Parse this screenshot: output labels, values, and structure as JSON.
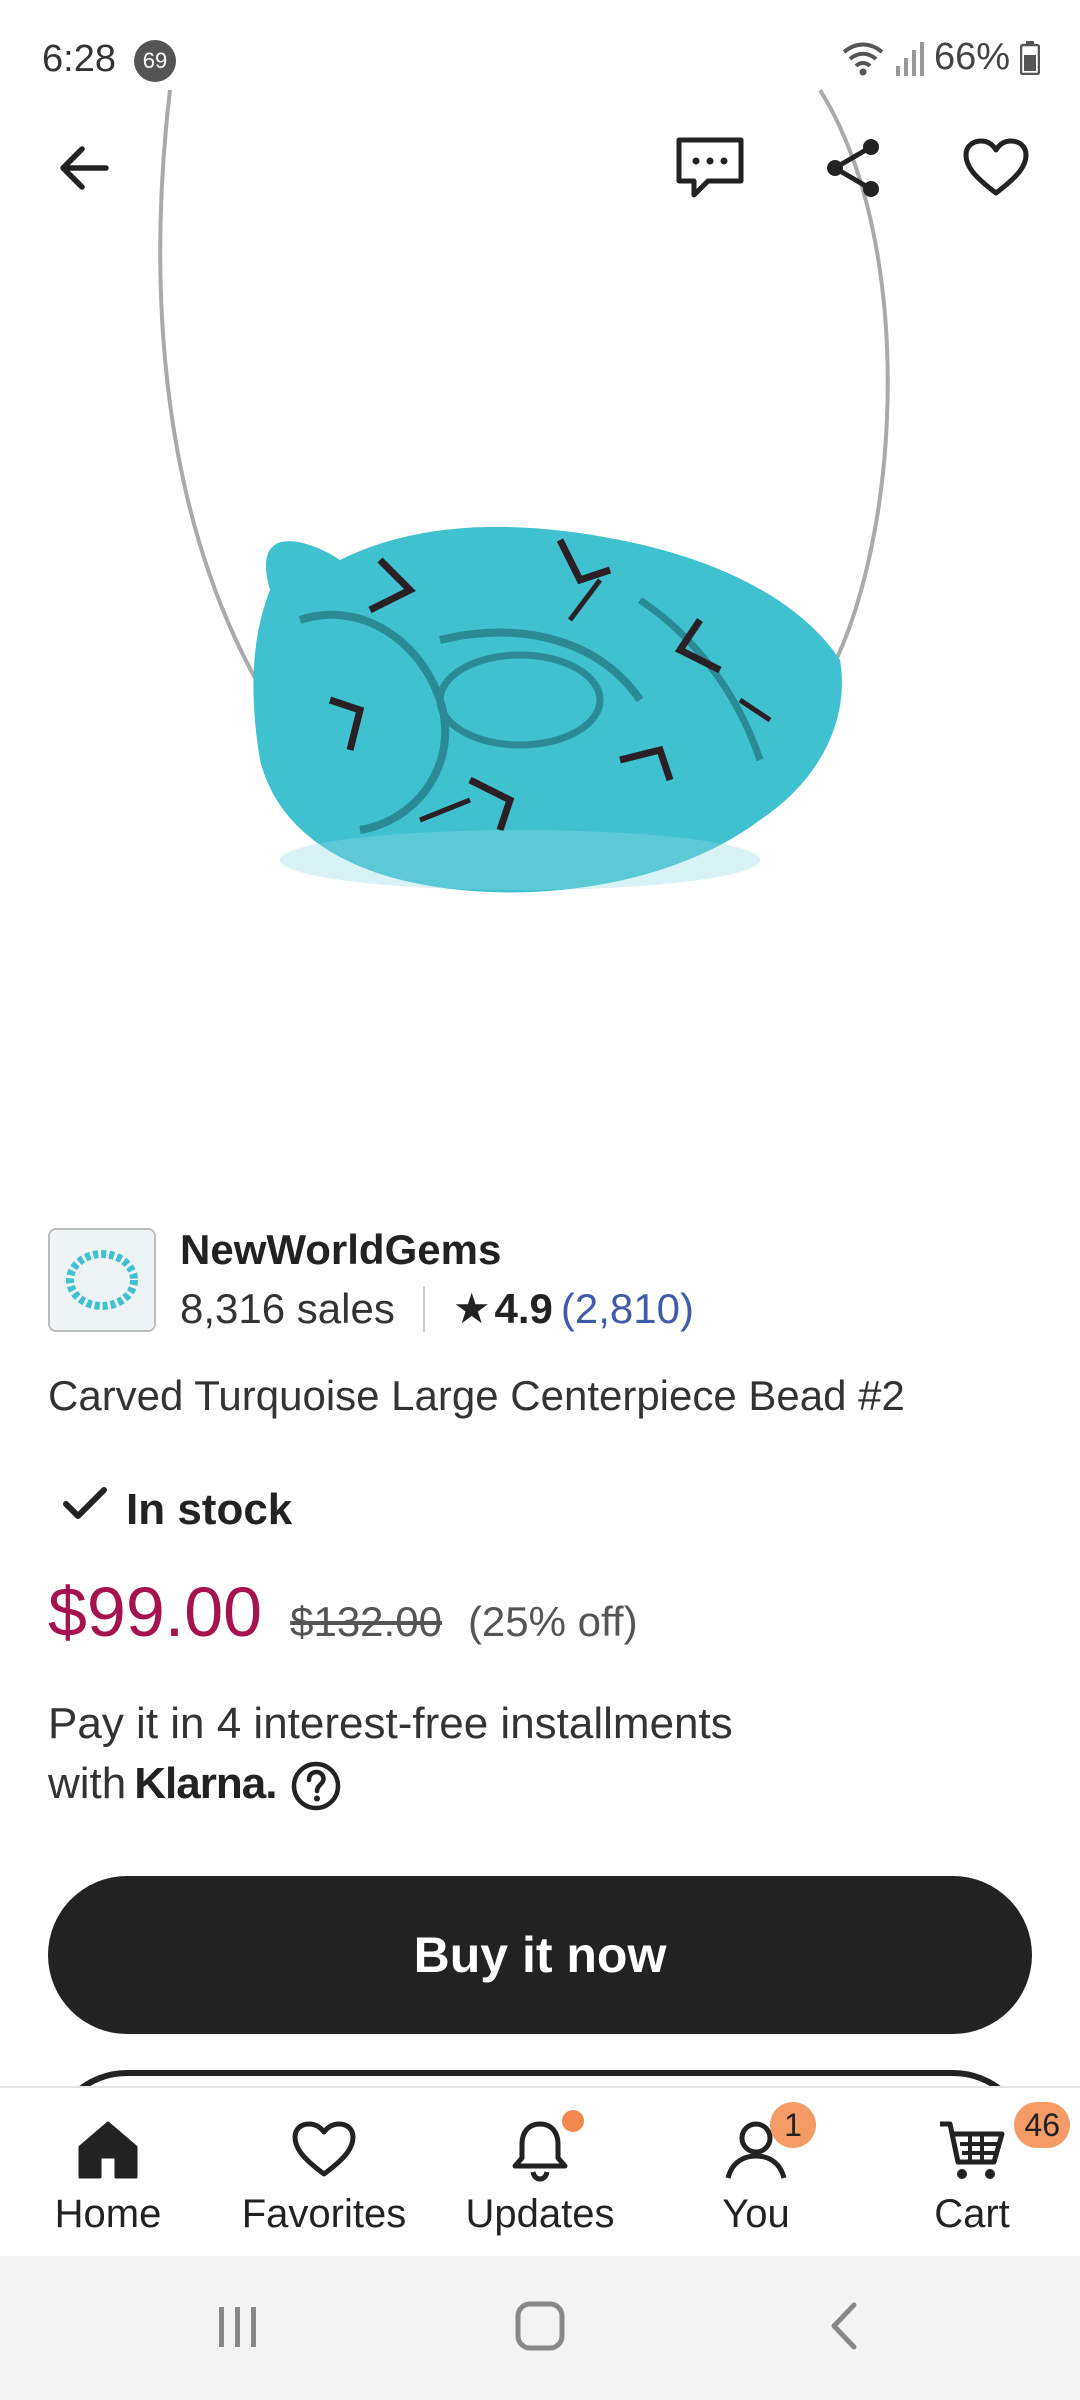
{
  "status_bar": {
    "time": "6:28",
    "notification_count": "69",
    "battery": "66%"
  },
  "shop": {
    "name": "NewWorldGems",
    "sales": "8,316 sales",
    "rating": "4.9",
    "reviews": "(2,810)"
  },
  "product": {
    "title": "Carved Turquoise Large Centerpiece Bead #2",
    "stock": "In stock",
    "price": "$99.00",
    "original_price": "$132.00",
    "discount": "(25% off)"
  },
  "installments": {
    "line1": "Pay it in 4 interest-free installments",
    "line2": "with",
    "provider": "Klarna."
  },
  "actions": {
    "buy_now": "Buy it now"
  },
  "bottom_nav": {
    "home": "Home",
    "favorites": "Favorites",
    "updates": "Updates",
    "you": "You",
    "you_badge": "1",
    "cart": "Cart",
    "cart_badge": "46"
  },
  "colors": {
    "price": "#a6124d",
    "link": "#3f5ba9",
    "primary_button": "#222222",
    "badge": "#f59b66"
  }
}
